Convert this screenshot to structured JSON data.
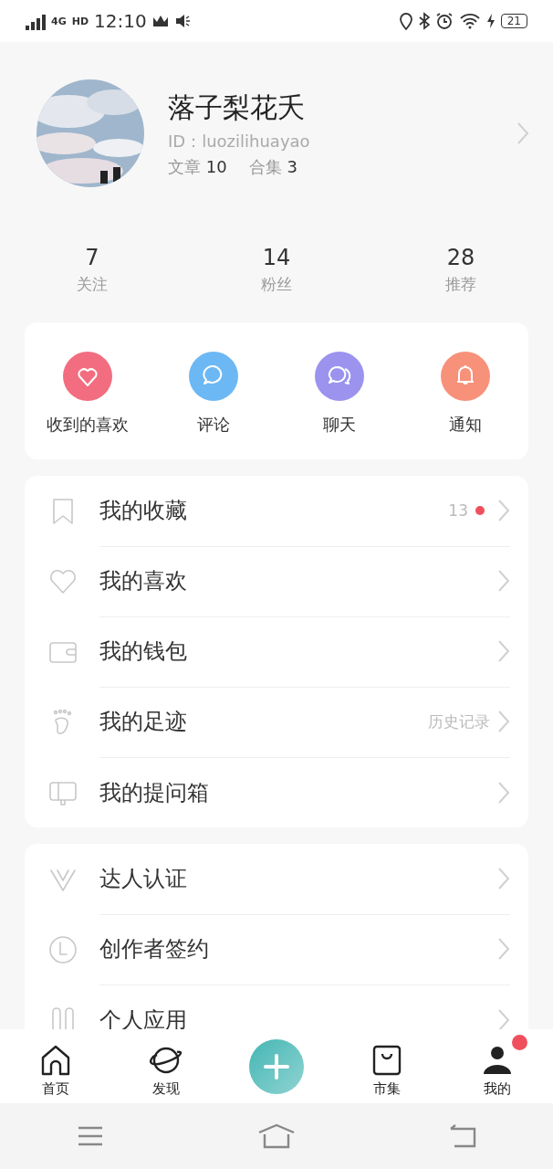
{
  "status_bar": {
    "network": "4G",
    "network_badge": "HD",
    "time": "12:10",
    "battery": "21"
  },
  "profile": {
    "name": "落子梨花夭",
    "id": "ID：luozilihuayao",
    "articles_label": "文章",
    "articles": "10",
    "collections_label": "合集",
    "collections": "3"
  },
  "stats": [
    {
      "value": "7",
      "label": "关注"
    },
    {
      "value": "14",
      "label": "粉丝"
    },
    {
      "value": "28",
      "label": "推荐"
    }
  ],
  "shortcuts": [
    {
      "kind": "heart",
      "label": "收到的喜欢",
      "color": "#f26d80"
    },
    {
      "kind": "comment",
      "label": "评论",
      "color": "#6cb8f4"
    },
    {
      "kind": "chat",
      "label": "聊天",
      "color": "#9b93ee"
    },
    {
      "kind": "bell",
      "label": "通知",
      "color": "#f7917a"
    }
  ],
  "menu_groups": [
    {
      "items": [
        {
          "kind": "bookmark",
          "label": "我的收藏",
          "detail": "13",
          "dot": true
        },
        {
          "kind": "heart",
          "label": "我的喜欢",
          "dot": false
        },
        {
          "kind": "wallet",
          "label": "我的钱包",
          "dot": false
        },
        {
          "kind": "foot",
          "label": "我的足迹",
          "detail": "历史记录",
          "dot": false
        },
        {
          "kind": "box",
          "label": "我的提问箱",
          "dot": false
        }
      ]
    },
    {
      "items": [
        {
          "kind": "v",
          "label": "达人认证",
          "dot": false
        },
        {
          "kind": "clock",
          "label": "创作者签约",
          "dot": false
        },
        {
          "kind": "apps",
          "label": "个人应用",
          "dot": false
        }
      ]
    }
  ],
  "tab_bar": [
    {
      "kind": "home",
      "label": "首页",
      "dot": false
    },
    {
      "kind": "planet",
      "label": "发现",
      "dot": false
    },
    {
      "kind": "add"
    },
    {
      "kind": "bag",
      "label": "市集",
      "dot": false
    },
    {
      "kind": "person",
      "label": "我的",
      "dot": true
    }
  ]
}
